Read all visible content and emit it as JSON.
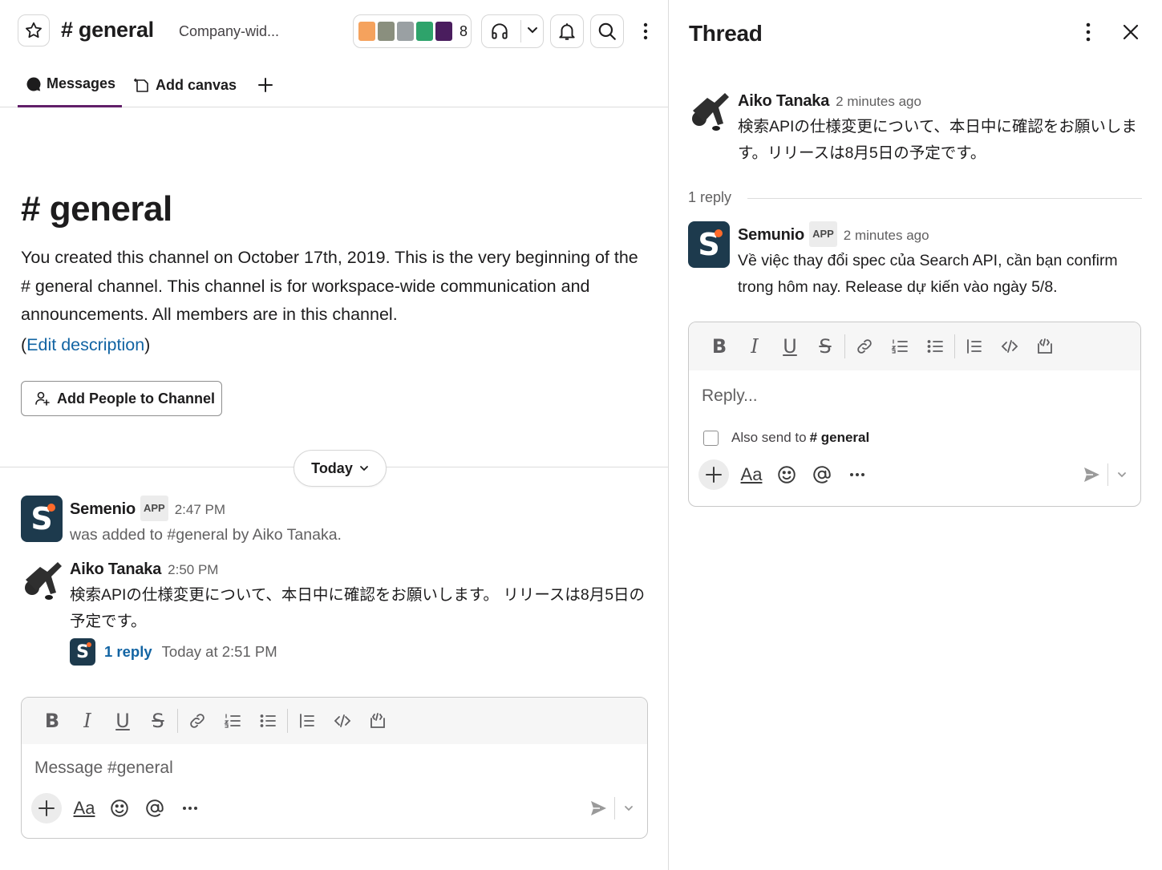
{
  "header": {
    "channel_title": "# general",
    "topic": "Company-wid...",
    "member_count": "8"
  },
  "tabs": {
    "messages": "Messages",
    "add_canvas": "Add canvas"
  },
  "intro": {
    "title": "# general",
    "description": "You created this channel on October 17th, 2019. This is the very beginning of the # general channel. This channel is for workspace-wide communication and announcements. All members are in this channel.",
    "edit_open": "(",
    "edit_link": "Edit description",
    "edit_close": ")",
    "add_people_button": "Add People to Channel"
  },
  "divider": {
    "label": "Today"
  },
  "messages": [
    {
      "author": "Semenio",
      "badge": "APP",
      "time": "2:47 PM",
      "text": "was added to #general by Aiko Tanaka."
    },
    {
      "author": "Aiko Tanaka",
      "time": "2:50 PM",
      "text": "検索APIの仕様変更について、本日中に確認をお願いします。 リリースは8月5日の予定です。",
      "reply_link": "1 reply",
      "reply_time": "Today at 2:51 PM"
    }
  ],
  "composer": {
    "placeholder": "Message #general",
    "text_style_label": "Aa"
  },
  "thread": {
    "title": "Thread",
    "parent": {
      "author": "Aiko Tanaka",
      "time": "2 minutes ago",
      "text": "検索APIの仕様変更について、本日中に確認をお願いします。リリースは8月5日の予定です。"
    },
    "reply_count": "1 reply",
    "reply": {
      "author": "Semunio",
      "badge": "APP",
      "time": "2 minutes ago",
      "text": "Về việc thay đổi spec của Search API, cần bạn confirm trong hôm nay. Release dự kiến vào ngày 5/8."
    },
    "composer": {
      "placeholder": "Reply...",
      "also_send_label": "Also send to",
      "also_send_channel": "# general",
      "text_style_label": "Aa"
    }
  },
  "colors": {
    "accent": "#611f69",
    "link": "#1264a3",
    "app_avatar": "#1d3a4d",
    "app_avatar_dot": "#ff6a2a"
  }
}
